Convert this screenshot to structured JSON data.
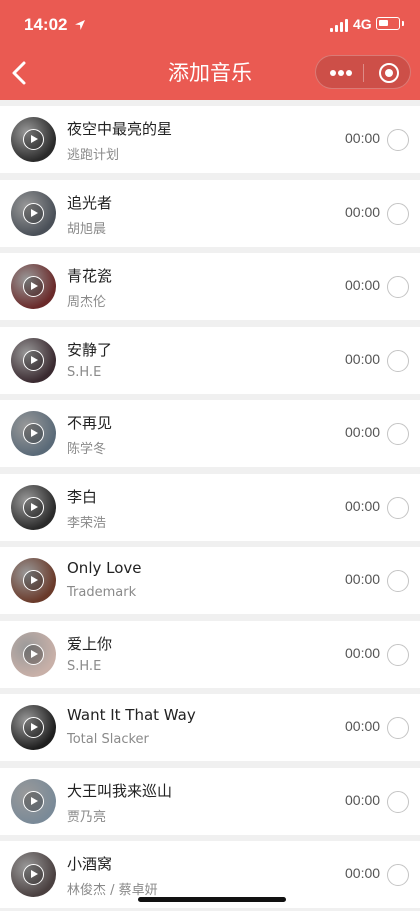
{
  "status_bar": {
    "time": "14:02",
    "network": "4G"
  },
  "nav": {
    "title": "添加音乐",
    "back_icon": "chevron-left-icon",
    "more_icon": "more-dots-icon",
    "close_icon": "record-circle-icon"
  },
  "colors": {
    "header_bg": "#ea5a52",
    "header_text": "#ffffff",
    "list_bg": "#ffffff",
    "divider": "#f0f0f0"
  },
  "songs": [
    {
      "title": "夜空中最亮的星",
      "artist": "逃跑计划",
      "duration": "00:00",
      "cover": "#2a2a2a"
    },
    {
      "title": "追光者",
      "artist": "胡旭晨",
      "duration": "00:00",
      "cover": "#4a5058"
    },
    {
      "title": "青花瓷",
      "artist": "周杰伦",
      "duration": "00:00",
      "cover": "#6a2a2a"
    },
    {
      "title": "安静了",
      "artist": "S.H.E",
      "duration": "00:00",
      "cover": "#3a2a30"
    },
    {
      "title": "不再见",
      "artist": "陈学冬",
      "duration": "00:00",
      "cover": "#5a6a78"
    },
    {
      "title": "李白",
      "artist": "李荣浩",
      "duration": "00:00",
      "cover": "#2a2a2a"
    },
    {
      "title": "Only Love",
      "artist": "Trademark",
      "duration": "00:00",
      "cover": "#6a3a2a"
    },
    {
      "title": "爱上你",
      "artist": "S.H.E",
      "duration": "00:00",
      "cover": "#c8b0a8"
    },
    {
      "title": "Want It That Way",
      "artist": "Total Slacker",
      "duration": "00:00",
      "cover": "#1e1e1e"
    },
    {
      "title": "大王叫我来巡山",
      "artist": "贾乃亮",
      "duration": "00:00",
      "cover": "#7a8a98"
    },
    {
      "title": "小酒窝",
      "artist": "林俊杰 / 蔡卓妍",
      "duration": "00:00",
      "cover": "#4a4040"
    }
  ]
}
